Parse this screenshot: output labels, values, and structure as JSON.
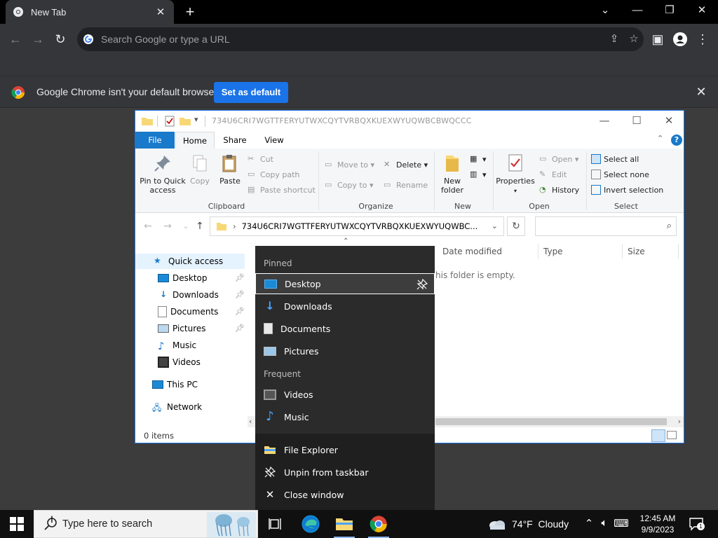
{
  "browser": {
    "tab_title": "New Tab",
    "tab_close": "✕",
    "new_tab": "+",
    "omnibox_placeholder": "Search Google or type a URL",
    "infobar_text": "Google Chrome isn't your default browser",
    "infobar_button": "Set as default",
    "infobar_close": "✕",
    "accent_color": "#1a73e8"
  },
  "explorer": {
    "title": "734U6CRI7WGTTFERYUTWXCQYTVRBQXKUEXWYUQWBCBWQCCC",
    "tabs": [
      "File",
      "Home",
      "Share",
      "View"
    ],
    "ribbon": {
      "clipboard": {
        "label": "Clipboard",
        "pin_line1": "Pin to Quick",
        "pin_line2": "access",
        "copy": "Copy",
        "paste": "Paste",
        "cut": "Cut",
        "copy_path": "Copy path",
        "paste_shortcut": "Paste shortcut"
      },
      "organize": {
        "label": "Organize",
        "move_to": "Move to",
        "copy_to": "Copy to",
        "delete": "Delete",
        "rename": "Rename"
      },
      "new": {
        "label": "New",
        "new_folder_line1": "New",
        "new_folder_line2": "folder"
      },
      "open": {
        "label": "Open",
        "properties": "Properties",
        "open": "Open",
        "edit": "Edit",
        "history": "History"
      },
      "select": {
        "label": "Select",
        "select_all": "Select all",
        "select_none": "Select none",
        "invert_selection": "Invert selection"
      }
    },
    "address": "734U6CRI7WGTTFERYUTWXCQYTVRBQXKUEXWYUQWBC...",
    "nav": {
      "quick_access": "Quick access",
      "items": [
        "Desktop",
        "Downloads",
        "Documents",
        "Pictures",
        "Music",
        "Videos"
      ],
      "this_pc": "This PC",
      "network": "Network"
    },
    "columns": [
      "Date modified",
      "Type",
      "Size"
    ],
    "empty_message": "his folder is empty.",
    "status": "0 items"
  },
  "jumplist": {
    "pinned_header": "Pinned",
    "pinned": [
      "Desktop",
      "Downloads",
      "Documents",
      "Pictures"
    ],
    "frequent_header": "Frequent",
    "frequent": [
      "Videos",
      "Music"
    ],
    "actions": [
      "File Explorer",
      "Unpin from taskbar",
      "Close window"
    ]
  },
  "taskbar": {
    "search_placeholder": "Type here to search",
    "weather_temp": "74°F",
    "weather_desc": "Cloudy",
    "time": "12:45 AM",
    "date": "9/9/2023",
    "notification_count": "1"
  }
}
